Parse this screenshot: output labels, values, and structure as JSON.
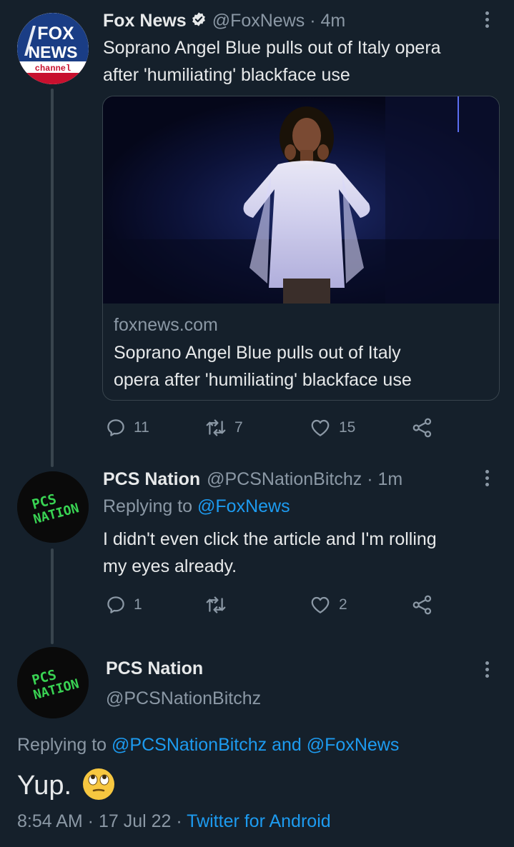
{
  "tweet1": {
    "name": "Fox News",
    "handle_time": "@FoxNews · 4m",
    "text_line1": "Soprano Angel Blue pulls out of Italy opera",
    "text_line2": "after 'humiliating' blackface use",
    "avatar_logo_text": [
      "FOX",
      "NEWS",
      "channel"
    ],
    "card": {
      "domain": "foxnews.com",
      "title_line1": "Soprano Angel Blue pulls out of Italy",
      "title_line2": "opera after 'humiliating' blackface use"
    },
    "actions": {
      "replies": "11",
      "retweets": "7",
      "likes": "15"
    }
  },
  "tweet2": {
    "name": "PCS Nation",
    "handle_time": "@PCSNationBitchz · 1m",
    "replying_prefix": "Replying to ",
    "replying_to": "@FoxNews",
    "text_line1": "I didn't even click the article and I'm rolling",
    "text_line2": "my eyes already.",
    "avatar_logo_text": [
      "PCS",
      "NATION"
    ],
    "actions": {
      "replies": "1",
      "retweets": "",
      "likes": "2"
    }
  },
  "main_tweet": {
    "name": "PCS Nation",
    "handle": "@PCSNationBitchz",
    "replying_prefix": "Replying to ",
    "replying_to": "@PCSNationBitchz and @FoxNews",
    "text": "Yup.",
    "emoji": "face-with-rolling-eyes",
    "timestamp": "8:54 AM · 17 Jul 22 · ",
    "source": "Twitter for Android"
  },
  "colors": {
    "background": "#15202b",
    "text": "#e7e9ea",
    "secondary": "#8b98a5",
    "accent": "#1d9bf0",
    "pcs_green": "#39d353"
  }
}
